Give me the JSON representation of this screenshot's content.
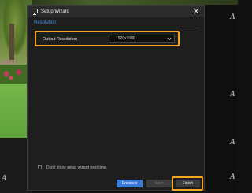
{
  "dialog": {
    "title": "Setup Wizard",
    "section_title": "Resolution"
  },
  "output_resolution": {
    "label": "Output Resolution",
    "value": "1920x1080"
  },
  "options": {
    "dont_show_label": "Don't show setup wizard next time."
  },
  "buttons": {
    "previous": "Previous",
    "next": "Next",
    "finish": "Finish"
  },
  "colors": {
    "accent": "#4a90e2",
    "highlight": "#f5a623",
    "dialog_bg": "#1e1e1e"
  },
  "icons": {
    "title": "monitor-icon",
    "close": "close-icon",
    "dropdown": "chevron-down-icon"
  }
}
